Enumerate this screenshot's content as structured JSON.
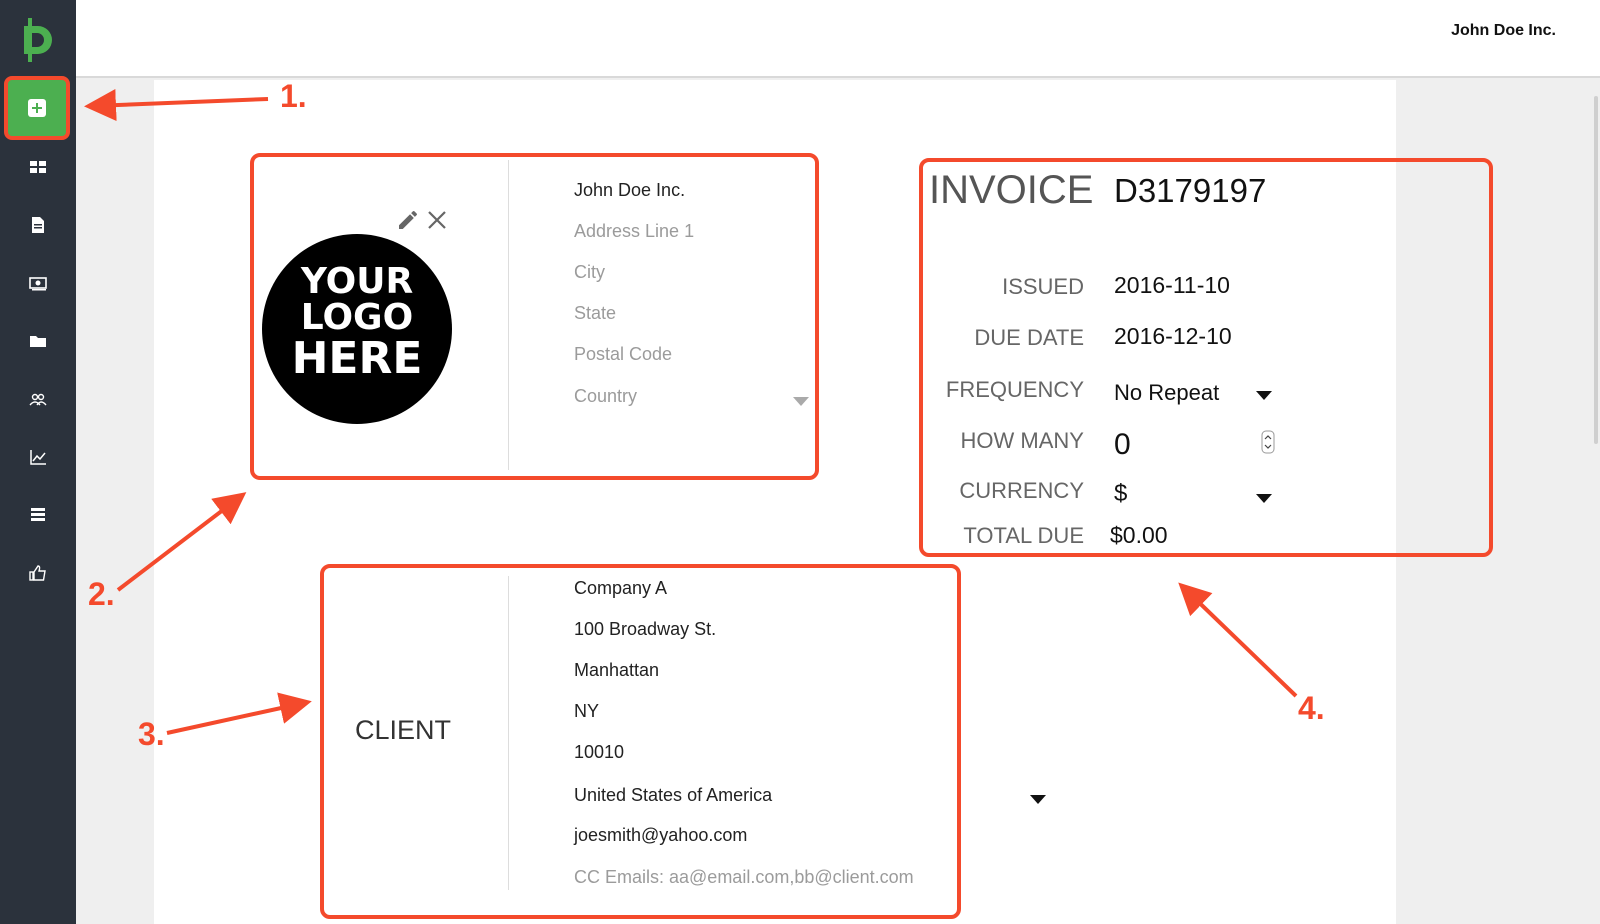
{
  "header": {
    "company": "John Doe Inc."
  },
  "sidebar": {
    "logo_icon": "brand-d-icon",
    "add_icon": "add-invoice-icon",
    "items": [
      {
        "icon": "dashboard-grid-icon"
      },
      {
        "icon": "document-icon"
      },
      {
        "icon": "money-icon"
      },
      {
        "icon": "folder-icon"
      },
      {
        "icon": "users-icon"
      },
      {
        "icon": "chart-icon"
      },
      {
        "icon": "list-icon"
      },
      {
        "icon": "thumbs-up-icon"
      }
    ]
  },
  "sender": {
    "logo_lines": [
      "YOUR",
      "LOGO",
      "HERE"
    ],
    "name": "John Doe Inc.",
    "address_placeholder": "Address Line 1",
    "city_placeholder": "City",
    "state_placeholder": "State",
    "postal_placeholder": "Postal Code",
    "country_placeholder": "Country"
  },
  "invoice": {
    "title": "INVOICE",
    "number": "D3179197",
    "issued_label": "ISSUED",
    "issued": "2016-11-10",
    "due_label": "DUE DATE",
    "due": "2016-12-10",
    "frequency_label": "FREQUENCY",
    "frequency": "No Repeat",
    "how_many_label": "HOW MANY",
    "how_many": "0",
    "currency_label": "CURRENCY",
    "currency": "$",
    "total_label": "TOTAL DUE",
    "total": "$0.00"
  },
  "client": {
    "label": "CLIENT",
    "name": "Company A",
    "address": "100 Broadway St.",
    "city": "Manhattan",
    "state": "NY",
    "postal": "10010",
    "country": "United States of America",
    "email": "joesmith@yahoo.com",
    "cc_emails": "CC Emails: aa@email.com,bb@client.com"
  },
  "callouts": [
    "1.",
    "2.",
    "3.",
    "4."
  ],
  "colors": {
    "accent_red": "#f44a2c",
    "brand_green": "#4caf50",
    "sidebar": "#2b323c"
  }
}
